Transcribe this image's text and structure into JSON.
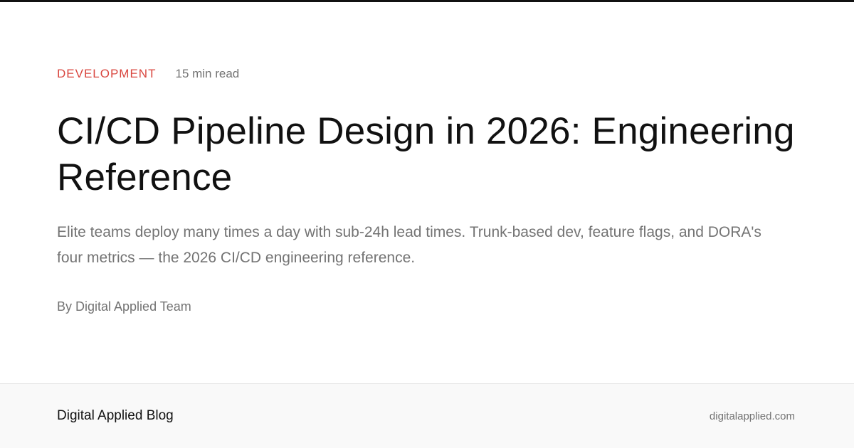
{
  "article": {
    "category": "DEVELOPMENT",
    "read_time": "15 min read",
    "title": "CI/CD Pipeline Design in 2026: Engineering Reference",
    "subtitle": "Elite teams deploy many times a day with sub-24h lead times. Trunk-based dev, feature flags, and DORA's four metrics — the 2026 CI/CD engineering reference.",
    "byline": "By Digital Applied Team"
  },
  "footer": {
    "brand": "Digital Applied Blog",
    "domain": "digitalapplied.com"
  },
  "colors": {
    "accent": "#d9463f",
    "text_primary": "#111111",
    "text_muted": "#737373",
    "footer_bg": "#f9f9f9"
  }
}
